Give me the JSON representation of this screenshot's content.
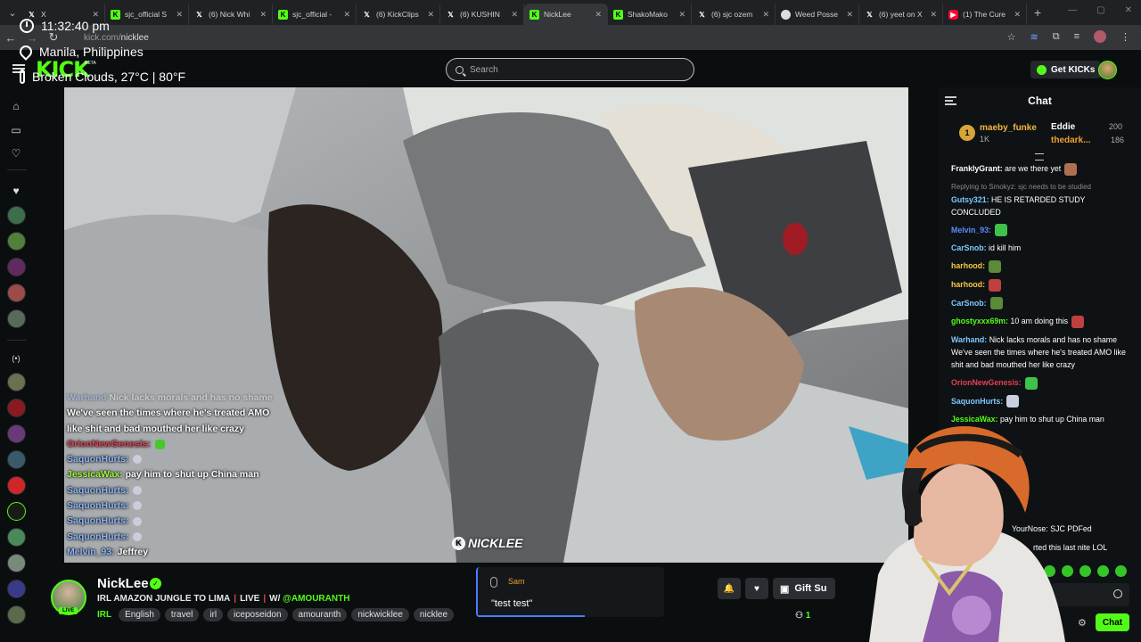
{
  "browser": {
    "tabs": [
      {
        "icon": "x-logo",
        "title": "X",
        "active": false
      },
      {
        "icon": "kick-logo",
        "title": "sjc_official S",
        "active": false
      },
      {
        "icon": "x-logo",
        "title": "(6) Nick Whi",
        "active": false
      },
      {
        "icon": "kick-logo",
        "title": "sjc_official -",
        "active": false
      },
      {
        "icon": "x-logo",
        "title": "(6) KickClips",
        "active": false
      },
      {
        "icon": "x-logo",
        "title": "(6) KUSHIN",
        "active": false
      },
      {
        "icon": "kick-logo",
        "title": "NickLee",
        "active": true
      },
      {
        "icon": "kick-logo",
        "title": "ShakoMako",
        "active": false
      },
      {
        "icon": "x-logo",
        "title": "(6) sjc ozem",
        "active": false
      },
      {
        "icon": "weed",
        "title": "Weed Posse",
        "active": false
      },
      {
        "icon": "x-logo",
        "title": "(6) yeet on X",
        "active": false
      },
      {
        "icon": "yt",
        "title": "(1) The Cure",
        "active": false
      }
    ],
    "url_host": "kick.com/",
    "url_path": "nicklee"
  },
  "overlay": {
    "time": "11:32:40 pm",
    "location": "Manila, Philippines",
    "weather": "Broken Clouds, 27°C | 80°F"
  },
  "header": {
    "logo": "KICK",
    "beta": "BETA",
    "search_placeholder": "Search",
    "get_kicks_label": "Get KICKs"
  },
  "stream_chat_overlay": [
    {
      "user": "Warhand",
      "text": "Nick lacks morals and has no shame",
      "color": "nm-blue",
      "faded": true
    },
    {
      "user": "",
      "text": "We've seen the times where he's treated AMO",
      "color": "",
      "faded": false
    },
    {
      "user": "",
      "text": "like shit and bad mouthed her like crazy",
      "color": "",
      "faded": false
    },
    {
      "user": "OrionNewGenesis:",
      "text": "",
      "color": "nm-red",
      "emote": "green"
    },
    {
      "user": "SaquonHurts:",
      "text": "",
      "color": "nm-blue",
      "emote": "small"
    },
    {
      "user": "JessicaWax:",
      "text": "pay him to shut up China man",
      "color": "nm-green"
    },
    {
      "user": "SaquonHurts:",
      "text": "",
      "color": "nm-blue",
      "emote": "small"
    },
    {
      "user": "SaquonHurts:",
      "text": "",
      "color": "nm-blue",
      "emote": "small"
    },
    {
      "user": "SaquonHurts:",
      "text": "",
      "color": "nm-blue",
      "emote": "small"
    },
    {
      "user": "SaquonHurts:",
      "text": "",
      "color": "nm-blue",
      "emote": "small"
    },
    {
      "user": "Melvin_93:",
      "text": "Jeffrey",
      "color": "nm-blue"
    }
  ],
  "watermark": "NICKLEE",
  "stream": {
    "name": "NickLee",
    "live": "LIVE",
    "title_part1": "IRL AMAZON JUNGLE TO LIMA",
    "title_sep": "|",
    "title_part2": "LIVE",
    "title_part3": "W/",
    "title_mention": "@AMOURANTH",
    "category": "IRL",
    "tags": [
      "English",
      "travel",
      "irl",
      "iceposeidon",
      "amouranth",
      "nickwicklee",
      "nicklee"
    ],
    "gift_label": "Gift Su",
    "viewers": "1"
  },
  "alert": {
    "name": "Sam",
    "message": "\"test test\"",
    "progress": 0.57
  },
  "chat": {
    "title": "Chat",
    "leaderboard": {
      "rank": "1",
      "first_name": "maeby_funke",
      "first_count": "1K",
      "second_name": "Eddie",
      "second_count": "200",
      "third_name": "thedark...",
      "third_count": "186"
    },
    "messages": [
      {
        "user": "FranklyGrant:",
        "text": "are we there yet",
        "color": "#ffffff",
        "emote": "#b07050"
      },
      {
        "reply": "Replying to Smokyz: sjc needs to be studied",
        "user": "Gutsy321:",
        "text": "HE IS RETARDED STUDY CONCLUDED",
        "color": "#7ec8ff"
      },
      {
        "user": "Melvin_93:",
        "text": "",
        "color": "#5a8cff",
        "emote": "#3ec24a"
      },
      {
        "user": "CarSnob:",
        "text": "id kill him",
        "color": "#7ec8ff"
      },
      {
        "user": "harhood:",
        "text": "",
        "color": "#f5c842",
        "emote": "#5a8a3a"
      },
      {
        "user": "harhood:",
        "text": "",
        "color": "#f5c842",
        "emote": "#c04040"
      },
      {
        "user": "CarSnob:",
        "text": "",
        "color": "#7ec8ff",
        "emote": "#5a8a3a"
      },
      {
        "user": "ghostyxxx69m:",
        "text": "10 am doing this",
        "color": "#53fc18",
        "emote": "#c04040"
      },
      {
        "user": "Warhand:",
        "text": "Nick lacks morals and has no shame We've seen the times where he's treated AMO like shit and bad mouthed her like crazy",
        "color": "#7ec8ff"
      },
      {
        "user": "OrionNewGenesis:",
        "text": "",
        "color": "#e43f52",
        "emote": "#3ec24a"
      },
      {
        "user": "SaquonHurts:",
        "text": "",
        "color": "#7ec8ff",
        "emote": "#c8d0e0"
      },
      {
        "user": "JessicaWax:",
        "text": "pay him to shut up China man",
        "color": "#53fc18"
      }
    ],
    "partial_msg1": "YourNose: SJC PDFed",
    "partial_msg2": "rted this last nite LOL",
    "send_label": "Chat"
  }
}
